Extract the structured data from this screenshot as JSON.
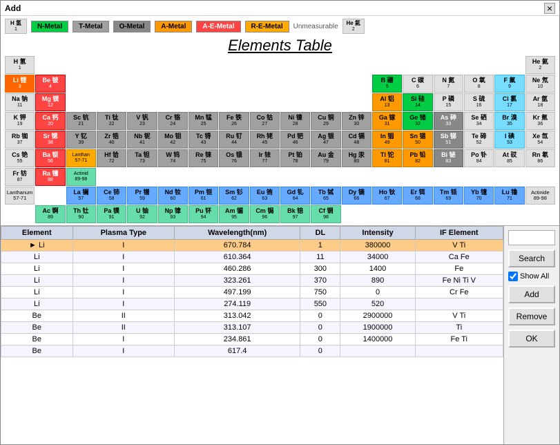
{
  "window": {
    "title": "Add",
    "close_label": "×"
  },
  "legend": {
    "items": [
      {
        "label": "N-Metal",
        "class": "cell-nmetal"
      },
      {
        "label": "T-Metal",
        "class": "cell-tmetal"
      },
      {
        "label": "O-Metal",
        "class": "cell-ometal"
      },
      {
        "label": "A-Metal",
        "class": "cell-ametal"
      },
      {
        "label": "A-E-Metal",
        "class": "cell-aemetal"
      },
      {
        "label": "R-E-Metal",
        "class": "cell-remetal"
      },
      {
        "label": "Unmeasurable",
        "class": ""
      }
    ]
  },
  "periodic_table": {
    "title": "Elements Table"
  },
  "table": {
    "headers": [
      "Element",
      "Plasma Type",
      "Wavelength(nm)",
      "DL",
      "Intensity",
      "IF Element"
    ],
    "rows": [
      {
        "selected": true,
        "element": "Li",
        "plasma": "I",
        "wavelength": "670.784",
        "dl": "1",
        "intensity": "380000",
        "if_element": "V Ti"
      },
      {
        "selected": false,
        "element": "Li",
        "plasma": "I",
        "wavelength": "610.364",
        "dl": "11",
        "intensity": "34000",
        "if_element": "Ca Fe"
      },
      {
        "selected": false,
        "element": "Li",
        "plasma": "I",
        "wavelength": "460.286",
        "dl": "300",
        "intensity": "1400",
        "if_element": "Fe"
      },
      {
        "selected": false,
        "element": "Li",
        "plasma": "I",
        "wavelength": "323.261",
        "dl": "370",
        "intensity": "890",
        "if_element": "Fe Ni Ti V"
      },
      {
        "selected": false,
        "element": "Li",
        "plasma": "I",
        "wavelength": "497.199",
        "dl": "750",
        "intensity": "0",
        "if_element": "Cr Fe"
      },
      {
        "selected": false,
        "element": "Li",
        "plasma": "I",
        "wavelength": "274.119",
        "dl": "550",
        "intensity": "520",
        "if_element": ""
      },
      {
        "selected": false,
        "element": "Be",
        "plasma": "II",
        "wavelength": "313.042",
        "dl": "0",
        "intensity": "2900000",
        "if_element": "V Ti"
      },
      {
        "selected": false,
        "element": "Be",
        "plasma": "II",
        "wavelength": "313.107",
        "dl": "0",
        "intensity": "1900000",
        "if_element": "Ti"
      },
      {
        "selected": false,
        "element": "Be",
        "plasma": "I",
        "wavelength": "234.861",
        "dl": "0",
        "intensity": "1400000",
        "if_element": "Fe Ti"
      },
      {
        "selected": false,
        "element": "Be",
        "plasma": "I",
        "wavelength": "617.4",
        "dl": "0",
        "intensity": "",
        "if_element": ""
      }
    ]
  },
  "side_panel": {
    "search_placeholder": "",
    "search_label": "Search",
    "show_all_label": "Show All",
    "add_label": "Add",
    "remove_label": "Remove",
    "ok_label": "OK",
    "show_all_checked": true
  }
}
